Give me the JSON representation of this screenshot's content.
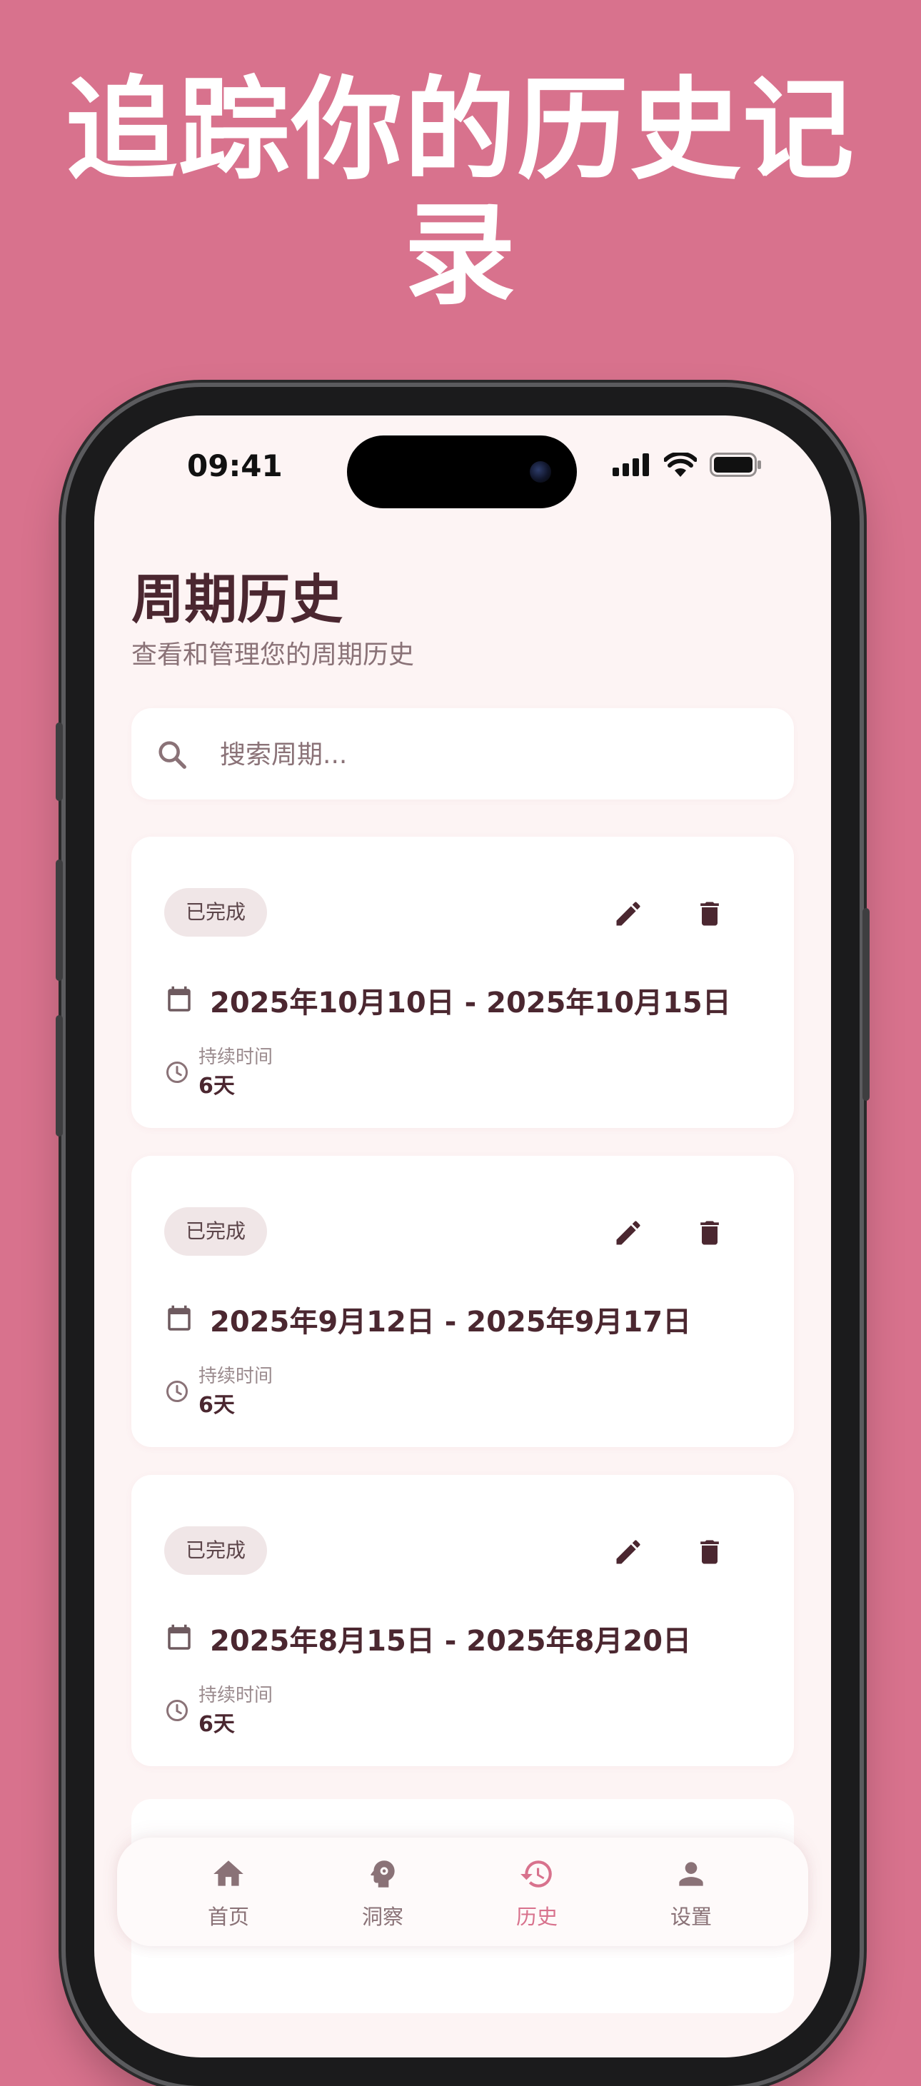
{
  "headline": "追踪你的历史记录",
  "status_bar": {
    "time": "09:41",
    "icons": [
      "cellular-signal-icon",
      "wifi-icon",
      "battery-icon"
    ]
  },
  "page": {
    "title": "周期历史",
    "subtitle": "查看和管理您的周期历史"
  },
  "search": {
    "placeholder": "搜索周期...",
    "value": ""
  },
  "cards": [
    {
      "status": "已完成",
      "date_range": "2025年10月10日 - 2025年10月15日",
      "duration_label": "持续时间",
      "duration_value": "6天"
    },
    {
      "status": "已完成",
      "date_range": "2025年9月12日 - 2025年9月17日",
      "duration_label": "持续时间",
      "duration_value": "6天"
    },
    {
      "status": "已完成",
      "date_range": "2025年8月15日 - 2025年8月20日",
      "duration_label": "持续时间",
      "duration_value": "6天"
    }
  ],
  "bottom_nav": {
    "items": [
      {
        "label": "首页",
        "icon": "home-icon",
        "active": false
      },
      {
        "label": "洞察",
        "icon": "insights-head-icon",
        "active": false
      },
      {
        "label": "历史",
        "icon": "history-icon",
        "active": true
      },
      {
        "label": "设置",
        "icon": "person-icon",
        "active": false
      }
    ]
  },
  "colors": {
    "background": "#d8728d",
    "accent": "#d8728d",
    "screen_bg": "#fdf4f4",
    "text_dark": "#4b2730",
    "text_muted": "#8a7277"
  }
}
